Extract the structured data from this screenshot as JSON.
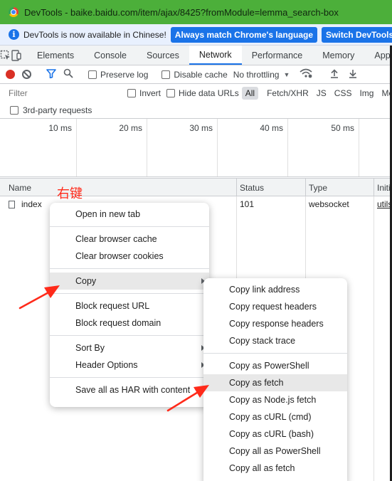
{
  "window": {
    "title": "DevTools - baike.baidu.com/item/ajax/8425?fromModule=lemma_search-box"
  },
  "infobar": {
    "message": "DevTools is now available in Chinese!",
    "btn_match": "Always match Chrome's language",
    "btn_switch": "Switch DevTools to Ch"
  },
  "tabs": [
    "Elements",
    "Console",
    "Sources",
    "Network",
    "Performance",
    "Memory",
    "Applic"
  ],
  "active_tab": "Network",
  "toolbar": {
    "preserve_log": "Preserve log",
    "disable_cache": "Disable cache",
    "throttling": "No throttling"
  },
  "filter": {
    "placeholder": "Filter",
    "invert": "Invert",
    "hide_data_urls": "Hide data URLs",
    "types": [
      "All",
      "Fetch/XHR",
      "JS",
      "CSS",
      "Img",
      "Med"
    ],
    "active_type": "All",
    "third_party": "3rd-party requests"
  },
  "timeline": {
    "ticks": [
      "10 ms",
      "20 ms",
      "30 ms",
      "40 ms",
      "50 ms"
    ]
  },
  "table": {
    "columns": [
      "Name",
      "Status",
      "Type",
      "Initi"
    ],
    "rows": [
      {
        "name": "index",
        "status": "101",
        "type": "websocket",
        "initiator": "utils"
      }
    ]
  },
  "annotation": {
    "text": "右键"
  },
  "context_menu": {
    "open_new_tab": "Open in new tab",
    "clear_cache": "Clear browser cache",
    "clear_cookies": "Clear browser cookies",
    "copy": "Copy",
    "block_url": "Block request URL",
    "block_domain": "Block request domain",
    "sort_by": "Sort By",
    "header_options": "Header Options",
    "save_har": "Save all as HAR with content"
  },
  "copy_submenu": {
    "copy_link": "Copy link address",
    "copy_req_headers": "Copy request headers",
    "copy_resp_headers": "Copy response headers",
    "copy_stack": "Copy stack trace",
    "copy_powershell": "Copy as PowerShell",
    "copy_fetch": "Copy as fetch",
    "copy_node_fetch": "Copy as Node.js fetch",
    "copy_curl_cmd": "Copy as cURL (cmd)",
    "copy_curl_bash": "Copy as cURL (bash)",
    "copy_all_powershell": "Copy all as PowerShell",
    "copy_all_fetch": "Copy all as fetch"
  },
  "colors": {
    "accent": "#1a73e8",
    "annotation": "#ff2a1a",
    "titlebar": "#4caf3a"
  }
}
